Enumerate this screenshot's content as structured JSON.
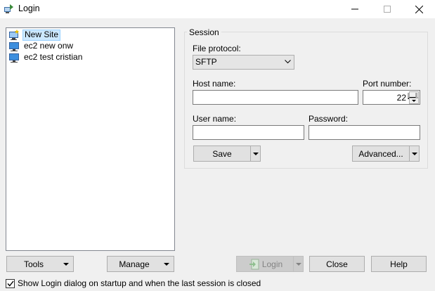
{
  "window": {
    "title": "Login",
    "icon": "winscp-app-icon"
  },
  "sites": [
    {
      "label": "New Site",
      "icon": "new-site-icon",
      "selected": true
    },
    {
      "label": "ec2 new onw",
      "icon": "computer-icon",
      "selected": false
    },
    {
      "label": "ec2 test cristian",
      "icon": "computer-icon",
      "selected": false
    }
  ],
  "session": {
    "group_label": "Session",
    "file_protocol_label": "File protocol:",
    "file_protocol_value": "SFTP",
    "host_name_label": "Host name:",
    "host_name_value": "",
    "port_label": "Port number:",
    "port_value": "22",
    "user_name_label": "User name:",
    "user_name_value": "",
    "password_label": "Password:",
    "password_value": "",
    "save_label": "Save",
    "advanced_label": "Advanced..."
  },
  "footer": {
    "tools_label": "Tools",
    "manage_label": "Manage",
    "login_label": "Login",
    "close_label": "Close",
    "help_label": "Help",
    "show_login_label": "Show Login dialog on startup and when the last session is closed",
    "show_login_checked": true
  }
}
